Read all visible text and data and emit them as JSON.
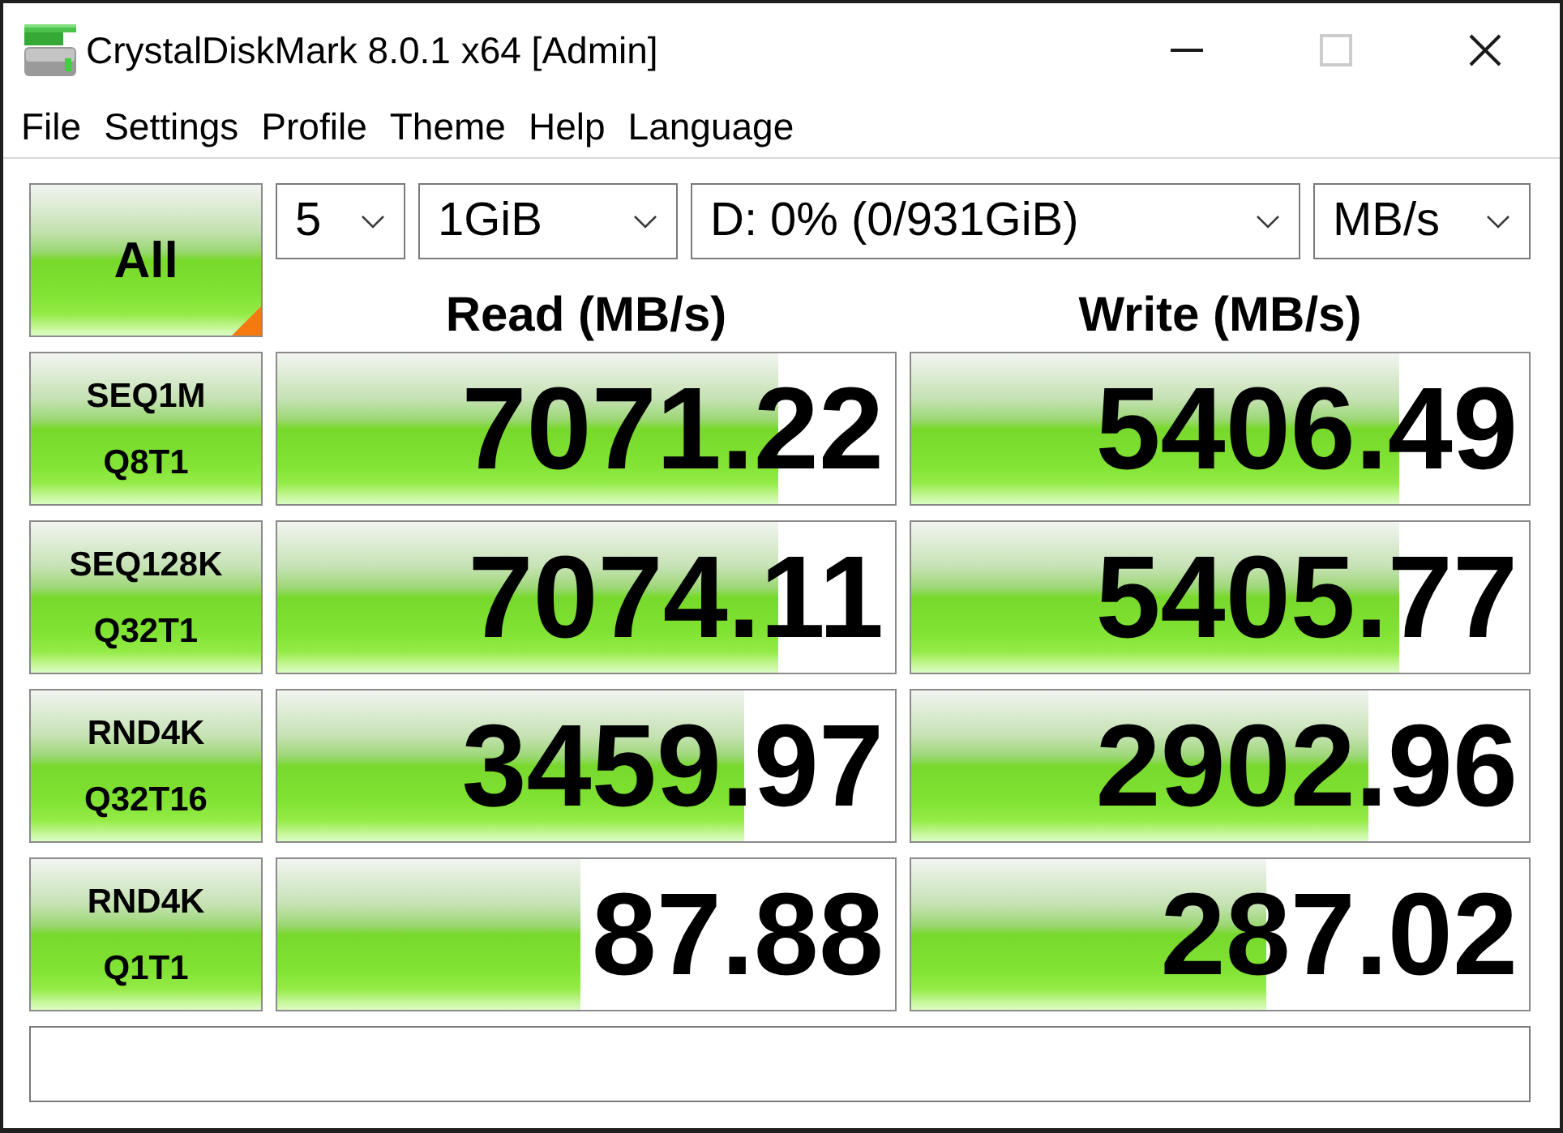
{
  "window": {
    "title": "CrystalDiskMark 8.0.1 x64 [Admin]",
    "controls": [
      {
        "kind": "minimize",
        "disabled": false
      },
      {
        "kind": "maximize",
        "disabled": true
      },
      {
        "kind": "close",
        "disabled": false
      }
    ]
  },
  "menu": [
    "File",
    "Settings",
    "Profile",
    "Theme",
    "Help",
    "Language"
  ],
  "all_button": {
    "label": "All"
  },
  "selectors": [
    {
      "kind": "count",
      "value": "5"
    },
    {
      "kind": "size",
      "value": "1GiB"
    },
    {
      "kind": "drive",
      "value": "D: 0% (0/931GiB)"
    },
    {
      "kind": "unit",
      "value": "MB/s"
    }
  ],
  "columns": [
    "Read (MB/s)",
    "Write (MB/s)"
  ],
  "tests": [
    {
      "name": "SEQ1M",
      "params": "Q8T1",
      "read": {
        "value": "7071.22",
        "level": 0.81
      },
      "write": {
        "value": "5406.49",
        "level": 0.79
      }
    },
    {
      "name": "SEQ128K",
      "params": "Q32T1",
      "read": {
        "value": "7074.11",
        "level": 0.81
      },
      "write": {
        "value": "5405.77",
        "level": 0.79
      }
    },
    {
      "name": "RND4K",
      "params": "Q32T16",
      "read": {
        "value": "3459.97",
        "level": 0.757
      },
      "write": {
        "value": "2902.96",
        "level": 0.74
      }
    },
    {
      "name": "RND4K",
      "params": "Q1T1",
      "read": {
        "value": "87.88",
        "level": 0.49
      },
      "write": {
        "value": "287.02",
        "level": 0.576
      }
    }
  ]
}
